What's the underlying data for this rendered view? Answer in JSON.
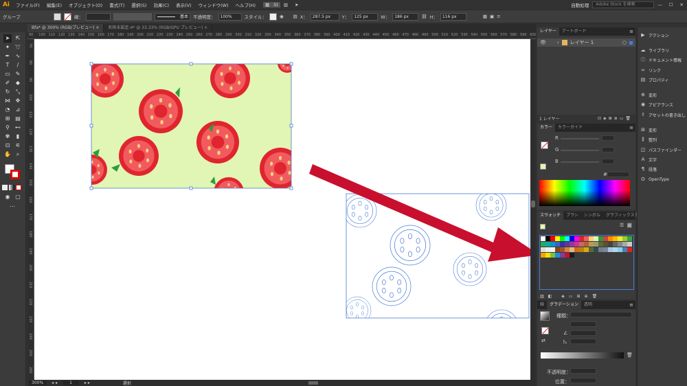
{
  "app": {
    "logo": "Ai"
  },
  "menu": [
    "ファイル(F)",
    "編集(E)",
    "オブジェクト(O)",
    "書式(T)",
    "選択(S)",
    "効果(C)",
    "表示(V)",
    "ウィンドウ(W)",
    "ヘルプ(H)"
  ],
  "menu_right": {
    "workspace": "自動処理",
    "search_placeholder": "Adobe Stock を検索"
  },
  "control": {
    "selection": "グループ",
    "stroke_label": "線：",
    "stroke_style": "基本",
    "opacity_label": "不透明度：",
    "opacity": "100%",
    "style_label": "スタイル：",
    "x_label": "X：",
    "x": "287.5 px",
    "y_label": "Y：",
    "y": "125 px",
    "w_label": "W：",
    "w": "186 px",
    "h_label": "H：",
    "h": "116 px"
  },
  "tabs": [
    {
      "label": "Bfa* @ 300% (RGB/プレビュー)"
    },
    {
      "label": "名称未設定-4* @ 33.33% (RGB/GPU プレビュー)"
    }
  ],
  "ruler_h": [
    "90",
    "100",
    "110",
    "120",
    "130",
    "140",
    "150",
    "160",
    "170",
    "180",
    "190",
    "200",
    "210",
    "220",
    "230",
    "240",
    "250",
    "260",
    "270",
    "280",
    "290",
    "300",
    "310",
    "320",
    "330",
    "340",
    "350",
    "360",
    "370",
    "380",
    "390",
    "400",
    "410",
    "420",
    "430",
    "440",
    "450",
    "460",
    "470",
    "480",
    "490",
    "500",
    "510",
    "520",
    "530",
    "540",
    "550",
    "560",
    "570",
    "580",
    "590",
    "600"
  ],
  "ruler_v": [
    "70",
    "80",
    "90",
    "100",
    "110",
    "120",
    "130",
    "140",
    "150",
    "160",
    "170",
    "180",
    "190",
    "200",
    "210",
    "220",
    "230",
    "240",
    "250",
    "260"
  ],
  "status": {
    "zoom": "300%",
    "page": "1",
    "tool": "選択"
  },
  "layers_panel": {
    "tabs": [
      "レイヤー",
      "アートボード"
    ],
    "layer_name": "レイヤー 1",
    "count": "1 レイヤー"
  },
  "color_panel": {
    "tabs": [
      "カラー",
      "カラーガイド"
    ],
    "r": "R",
    "g": "G",
    "b": "B",
    "hash": "#"
  },
  "swatches_panel": {
    "tabs": [
      "スウォッチ",
      "ブラシ",
      "シンボル",
      "グラフィックスタイル"
    ]
  },
  "gradient_panel": {
    "tabs": [
      "線",
      "グラデーション",
      "透明"
    ],
    "type_label": "種類：",
    "opacity_label": "不透明度：",
    "position_label": "位置："
  },
  "dock": [
    {
      "label": "アクション",
      "icon": "play-icon"
    },
    {
      "label": "ライブラリ",
      "icon": "library-icon"
    },
    {
      "label": "ドキュメント情報",
      "icon": "info-icon"
    },
    {
      "label": "リンク",
      "icon": "link-icon"
    },
    {
      "label": "プロパティ",
      "icon": "properties-icon"
    },
    {
      "label": "変形",
      "icon": "transform-icon"
    },
    {
      "label": "アピアランス",
      "icon": "appearance-icon"
    },
    {
      "label": "アセットの書き出し",
      "icon": "export-icon"
    },
    {
      "label": "変形",
      "icon": "transform-icon"
    },
    {
      "label": "整列",
      "icon": "align-icon"
    },
    {
      "label": "パスファインダー",
      "icon": "pathfinder-icon"
    },
    {
      "label": "文字",
      "icon": "character-icon"
    },
    {
      "label": "段落",
      "icon": "paragraph-icon"
    },
    {
      "label": "OpenType",
      "icon": "opentype-icon"
    }
  ],
  "colors": {
    "tomato_bg": "#e1f5b4",
    "tomato_red": "#e0252f",
    "arrow": "#c8102e",
    "selection": "#4a7bd8"
  }
}
